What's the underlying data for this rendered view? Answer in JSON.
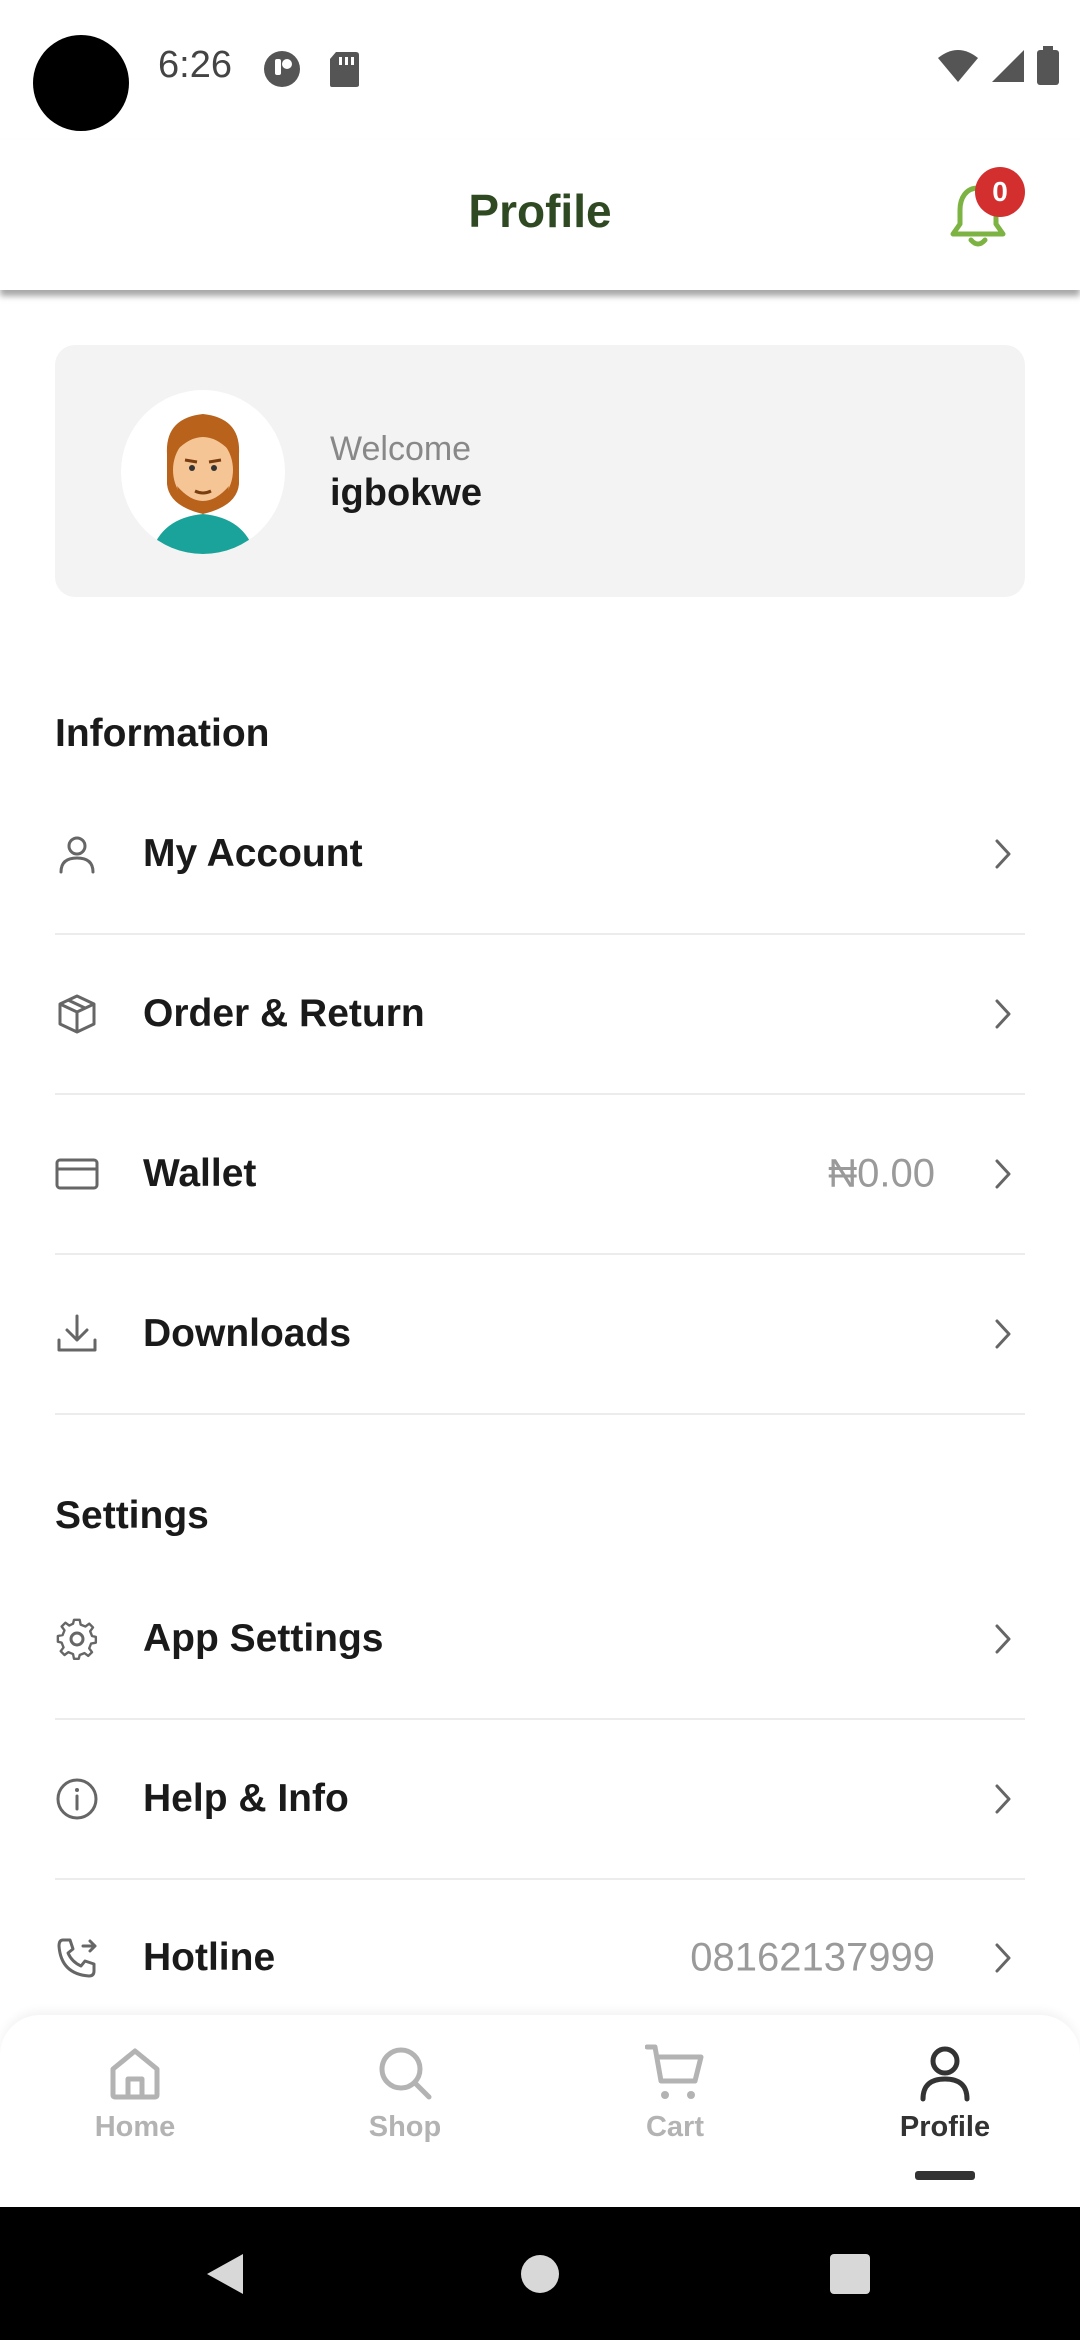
{
  "status_bar": {
    "time": "6:26"
  },
  "app_bar": {
    "title": "Profile",
    "notification_count": "0"
  },
  "welcome": {
    "label": "Welcome",
    "name": "igbokwe"
  },
  "sections": {
    "information": {
      "title": "Information",
      "items": [
        {
          "label": "My Account",
          "icon": "user-icon",
          "value": ""
        },
        {
          "label": "Order & Return",
          "icon": "box-icon",
          "value": ""
        },
        {
          "label": "Wallet",
          "icon": "card-icon",
          "value": "₦0.00"
        },
        {
          "label": "Downloads",
          "icon": "download-icon",
          "value": ""
        }
      ]
    },
    "settings": {
      "title": "Settings",
      "items": [
        {
          "label": "App Settings",
          "icon": "gear-icon",
          "value": ""
        },
        {
          "label": "Help & Info",
          "icon": "info-icon",
          "value": ""
        },
        {
          "label": "Hotline",
          "icon": "phone-forward-icon",
          "value": "08162137999"
        }
      ]
    }
  },
  "bottom_nav": {
    "items": [
      {
        "label": "Home",
        "icon": "home-icon",
        "active": false
      },
      {
        "label": "Shop",
        "icon": "search-icon",
        "active": false
      },
      {
        "label": "Cart",
        "icon": "cart-icon",
        "active": false
      },
      {
        "label": "Profile",
        "icon": "user-icon",
        "active": true
      }
    ]
  },
  "colors": {
    "title": "#2f4a22",
    "bell": "#7cb342",
    "badge": "#d32f2f",
    "card_bg": "#f3f3f3"
  }
}
